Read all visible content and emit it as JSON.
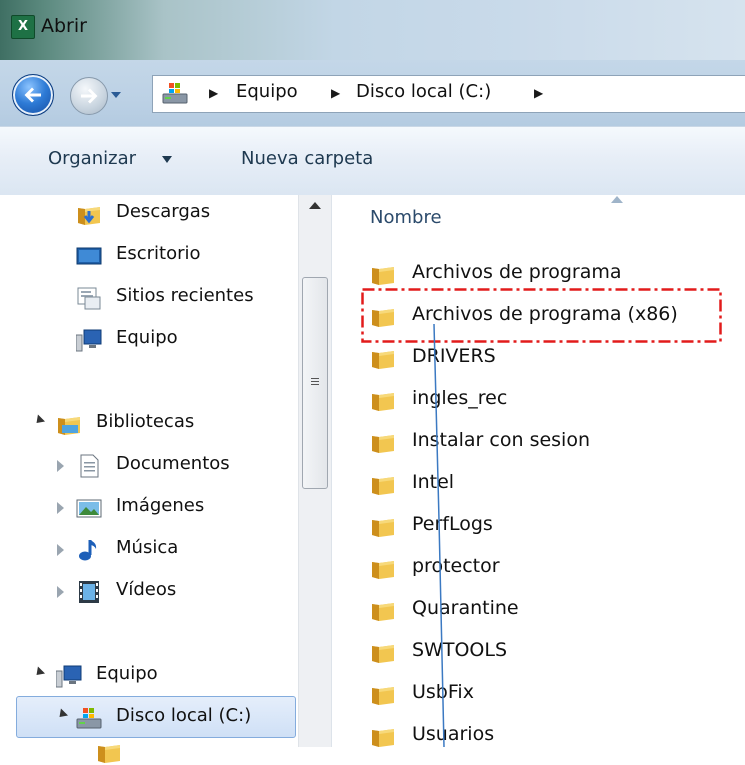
{
  "window": {
    "title": "Abrir",
    "app_icon": "excel-icon"
  },
  "navigation": {
    "back_icon": "back-arrow-icon",
    "forward_icon": "forward-arrow-icon",
    "breadcrumb": [
      "Equipo",
      "Disco local (C:)"
    ]
  },
  "toolbar": {
    "organize_label": "Organizar",
    "new_folder_label": "Nueva carpeta"
  },
  "nav_pane": {
    "favorites": [
      {
        "label": "Descargas",
        "icon": "downloads-folder-icon"
      },
      {
        "label": "Escritorio",
        "icon": "desktop-icon"
      },
      {
        "label": "Sitios recientes",
        "icon": "recent-places-icon"
      },
      {
        "label": "Equipo",
        "icon": "computer-icon"
      }
    ],
    "libraries": {
      "label": "Bibliotecas",
      "icon": "libraries-icon",
      "items": [
        {
          "label": "Documentos",
          "icon": "documents-icon"
        },
        {
          "label": "Imágenes",
          "icon": "pictures-icon"
        },
        {
          "label": "Música",
          "icon": "music-icon"
        },
        {
          "label": "Vídeos",
          "icon": "videos-icon"
        }
      ]
    },
    "computer": {
      "label": "Equipo",
      "icon": "computer-icon",
      "items": [
        {
          "label": "Disco local (C:)",
          "icon": "local-disk-icon",
          "selected": true
        }
      ]
    }
  },
  "file_list": {
    "column_header": "Nombre",
    "items": [
      "Archivos de programa",
      "Archivos de programa (x86)",
      "DRIVERS",
      "ingles_rec",
      "Instalar con sesion",
      "Intel",
      "PerfLogs",
      "protector",
      "Quarantine",
      "SWTOOLS",
      "UsbFix",
      "Usuarios"
    ],
    "highlighted_item": "Archivos de programa (x86)"
  },
  "colors": {
    "highlight_box": "#e21b1b",
    "selection": "#cfe0f6",
    "folder": "#e8b53c"
  }
}
